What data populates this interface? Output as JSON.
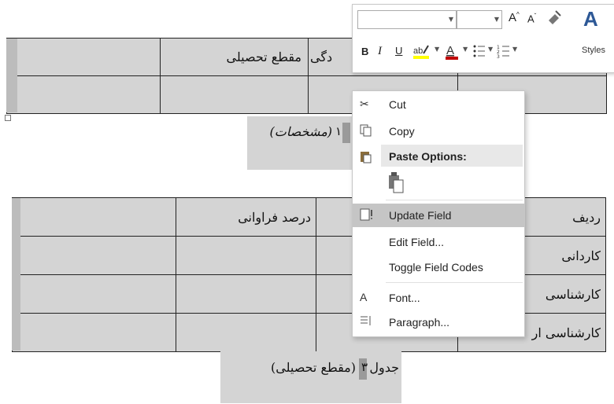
{
  "table1": {
    "header_col_education": "مقطع تحصیلی",
    "header_col_partial": "دگی"
  },
  "caption1": {
    "number": "۱",
    "text": "(مشخصات)"
  },
  "table2": {
    "headers": [
      "ردیف",
      "درصد فراوانی"
    ],
    "rows": [
      "کاردانی",
      "کارشناسی",
      "کارشناسی ار"
    ]
  },
  "caption2": {
    "prefix": "جدول",
    "number": "۳",
    "text": "(مقطع تحصیلی)"
  },
  "mini_toolbar": {
    "font_name_value": "",
    "font_size_value": "",
    "bold": "B",
    "italic": "I",
    "underline": "U",
    "grow_font": "A",
    "shrink_font": "A",
    "styles_label": "Styles"
  },
  "context_menu": {
    "items": [
      {
        "label": "Cut",
        "icon": "scissors-icon"
      },
      {
        "label": "Copy",
        "icon": "copy-icon"
      },
      {
        "label": "Paste Options:",
        "icon": "paste-icon"
      },
      {
        "label": "Update Field",
        "icon": "update-field-icon"
      },
      {
        "label": "Edit Field...",
        "icon": ""
      },
      {
        "label": "Toggle Field Codes",
        "icon": ""
      },
      {
        "label": "Font...",
        "icon": "font-icon"
      },
      {
        "label": "Paragraph...",
        "icon": "paragraph-icon"
      }
    ]
  },
  "colors": {
    "highlight": "#c5c5c5",
    "table_shade": "#d4d4d4",
    "font_color_bar": "#c00000",
    "highlight_bar": "#ffff00"
  }
}
